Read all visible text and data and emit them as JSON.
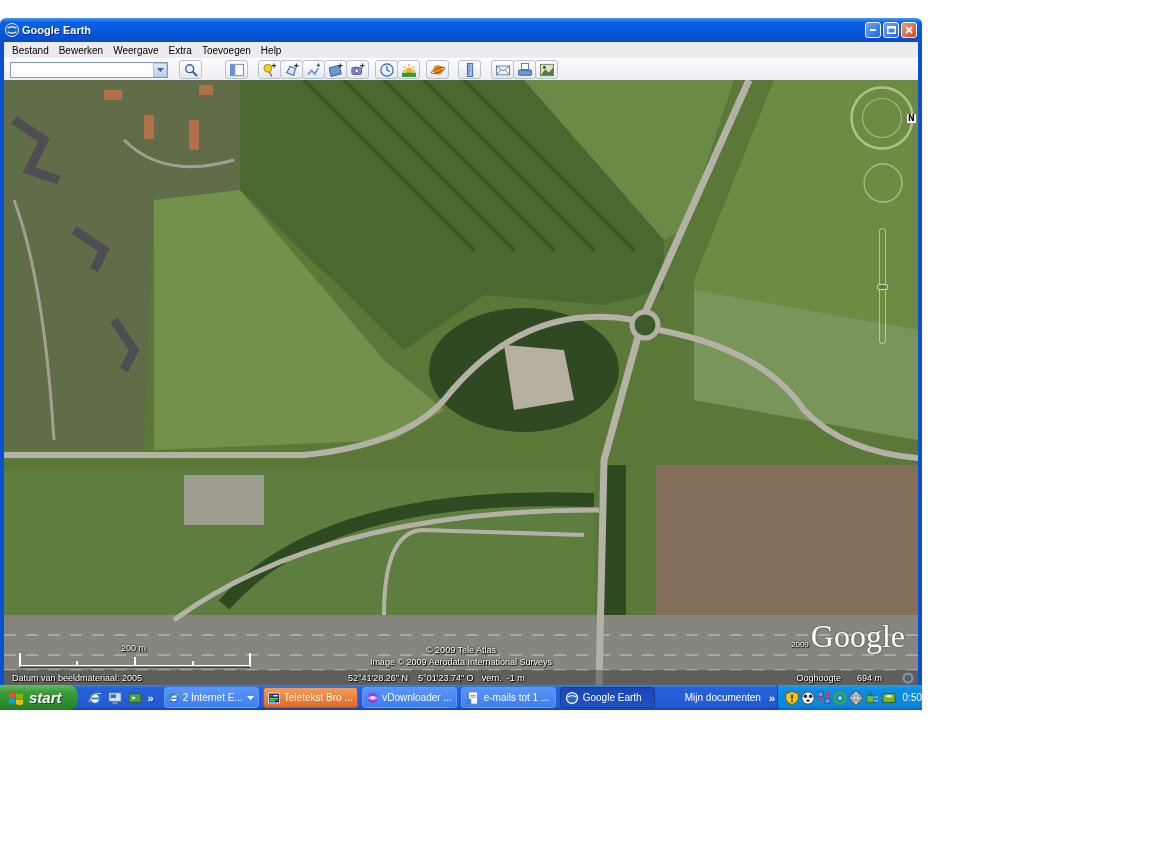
{
  "window": {
    "title": "Google Earth",
    "menu": [
      "Bestand",
      "Bewerken",
      "Weergave",
      "Extra",
      "Toevoegen",
      "Help"
    ]
  },
  "map": {
    "north": "N",
    "zoom": {
      "level": 0.49
    },
    "scale": "200 m",
    "logo": {
      "year": "2009",
      "name": "Google"
    },
    "credits": [
      "© 2009 Tele Atlas",
      "Image © 2009 Aerodata International Surveys"
    ],
    "status": {
      "imagery_date": "Datum van beeldmateriaal: 2005",
      "latitude": "52°41'28.26\" N",
      "longitude": "5°01'23.74\" O",
      "elevation": "vern.  -1 m",
      "eye_altitude_label": "Ooghoogte",
      "eye_altitude": "694 m"
    }
  },
  "taskbar": {
    "start": "start",
    "quick_launch_more": "»",
    "tasks": [
      {
        "label": "2 Internet E...",
        "grouped": true,
        "flashing": false,
        "selected": false
      },
      {
        "label": "Teletekst Bro ...",
        "grouped": false,
        "flashing": true,
        "selected": false
      },
      {
        "label": "vDownloader ...",
        "grouped": false,
        "flashing": false,
        "selected": false
      },
      {
        "label": "e-mails tot 1 ...",
        "grouped": false,
        "flashing": false,
        "selected": false
      },
      {
        "label": "Google Earth",
        "grouped": false,
        "flashing": false,
        "selected": true
      }
    ],
    "deskband": {
      "label": "Mijn documenten",
      "more": "»"
    },
    "clock": "0:50"
  }
}
